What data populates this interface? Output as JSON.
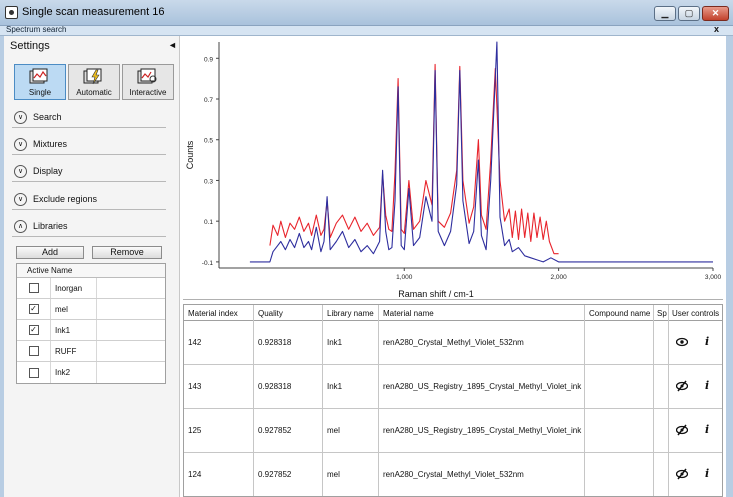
{
  "window": {
    "title": "Single scan measurement 16",
    "panel_title": "Spectrum search",
    "panel_close": "x"
  },
  "sidebar": {
    "heading": "Settings",
    "collapse_glyph": "◄",
    "modes": [
      {
        "label": "Single",
        "selected": true
      },
      {
        "label": "Automatic",
        "selected": false
      },
      {
        "label": "Interactive",
        "selected": false
      }
    ],
    "sections": [
      {
        "label": "Search",
        "expanded": false
      },
      {
        "label": "Mixtures",
        "expanded": false
      },
      {
        "label": "Display",
        "expanded": false
      },
      {
        "label": "Exclude regions",
        "expanded": false
      },
      {
        "label": "Libraries",
        "expanded": true
      }
    ],
    "libraries": {
      "add_label": "Add",
      "remove_label": "Remove",
      "col_active": "Active",
      "col_name": "Name",
      "rows": [
        {
          "name": "Inorgan",
          "active": false
        },
        {
          "name": "mel",
          "active": true
        },
        {
          "name": "Ink1",
          "active": true
        },
        {
          "name": "RUFF",
          "active": false
        },
        {
          "name": "Ink2",
          "active": false
        }
      ]
    }
  },
  "chart_data": {
    "type": "line",
    "xlabel": "Raman shift / cm-1",
    "ylabel": "Counts",
    "xlim": [
      -200,
      3000
    ],
    "ylim": [
      -0.13,
      0.98
    ],
    "x_ticks": [
      "1,000",
      "2,000",
      "3,000"
    ],
    "y_ticks": [
      "-0.1",
      "0.1",
      "0.3",
      "0.5",
      "0.7",
      "0.9"
    ],
    "grid": false,
    "series": [
      {
        "color": "#e8242c",
        "points": [
          [
            130,
            -0.02
          ],
          [
            150,
            0.08
          ],
          [
            180,
            0.03
          ],
          [
            200,
            0.1
          ],
          [
            230,
            0.02
          ],
          [
            260,
            0.09
          ],
          [
            290,
            0.06
          ],
          [
            320,
            0.12
          ],
          [
            350,
            0.05
          ],
          [
            380,
            0.09
          ],
          [
            400,
            0.03
          ],
          [
            430,
            0.13
          ],
          [
            460,
            0.03
          ],
          [
            480,
            0.06
          ],
          [
            500,
            0.2
          ],
          [
            520,
            0.02
          ],
          [
            560,
            0.09
          ],
          [
            600,
            0.13
          ],
          [
            640,
            0.06
          ],
          [
            680,
            0.12
          ],
          [
            720,
            0.05
          ],
          [
            760,
            0.09
          ],
          [
            800,
            0.03
          ],
          [
            840,
            0.07
          ],
          [
            860,
            0.33
          ],
          [
            880,
            0.13
          ],
          [
            900,
            0.06
          ],
          [
            920,
            0.05
          ],
          [
            940,
            0.34
          ],
          [
            960,
            0.8
          ],
          [
            980,
            0.06
          ],
          [
            1000,
            0.04
          ],
          [
            1030,
            0.3
          ],
          [
            1060,
            0.06
          ],
          [
            1100,
            0.1
          ],
          [
            1140,
            0.3
          ],
          [
            1180,
            0.18
          ],
          [
            1200,
            0.87
          ],
          [
            1220,
            0.1
          ],
          [
            1260,
            0.07
          ],
          [
            1300,
            0.14
          ],
          [
            1340,
            0.35
          ],
          [
            1360,
            0.86
          ],
          [
            1380,
            0.3
          ],
          [
            1420,
            0.09
          ],
          [
            1450,
            0.17
          ],
          [
            1480,
            0.5
          ],
          [
            1500,
            0.13
          ],
          [
            1530,
            0.06
          ],
          [
            1560,
            0.4
          ],
          [
            1590,
            0.85
          ],
          [
            1620,
            0.3
          ],
          [
            1650,
            0.1
          ],
          [
            1680,
            0.16
          ],
          [
            1700,
            0.02
          ],
          [
            1720,
            0.15
          ],
          [
            1740,
            0.01
          ],
          [
            1760,
            0.16
          ],
          [
            1780,
            0.02
          ],
          [
            1800,
            0.14
          ],
          [
            1820,
            0.0
          ],
          [
            1840,
            0.14
          ],
          [
            1860,
            0.02
          ],
          [
            1880,
            0.12
          ],
          [
            1900,
            0.01
          ],
          [
            1920,
            0.1
          ],
          [
            1940,
            0.0
          ],
          [
            1970,
            -0.06
          ],
          [
            2000,
            -0.06
          ]
        ]
      },
      {
        "color": "#2e2e9e",
        "points": [
          [
            0,
            -0.1
          ],
          [
            130,
            -0.1
          ],
          [
            150,
            -0.05
          ],
          [
            180,
            -0.02
          ],
          [
            200,
            0.0
          ],
          [
            230,
            -0.04
          ],
          [
            260,
            0.01
          ],
          [
            290,
            -0.03
          ],
          [
            320,
            0.04
          ],
          [
            350,
            -0.03
          ],
          [
            380,
            0.0
          ],
          [
            400,
            -0.04
          ],
          [
            430,
            0.07
          ],
          [
            460,
            -0.05
          ],
          [
            480,
            0.0
          ],
          [
            500,
            0.22
          ],
          [
            520,
            -0.04
          ],
          [
            560,
            0.0
          ],
          [
            600,
            0.05
          ],
          [
            640,
            -0.03
          ],
          [
            680,
            0.01
          ],
          [
            720,
            -0.05
          ],
          [
            760,
            -0.02
          ],
          [
            800,
            -0.06
          ],
          [
            840,
            0.0
          ],
          [
            860,
            0.35
          ],
          [
            880,
            0.05
          ],
          [
            900,
            -0.04
          ],
          [
            920,
            -0.03
          ],
          [
            940,
            0.2
          ],
          [
            960,
            0.76
          ],
          [
            980,
            -0.02
          ],
          [
            1000,
            -0.04
          ],
          [
            1030,
            0.26
          ],
          [
            1060,
            -0.02
          ],
          [
            1100,
            0.02
          ],
          [
            1140,
            0.22
          ],
          [
            1180,
            0.1
          ],
          [
            1200,
            0.84
          ],
          [
            1220,
            0.05
          ],
          [
            1260,
            -0.02
          ],
          [
            1300,
            0.05
          ],
          [
            1340,
            0.28
          ],
          [
            1360,
            0.84
          ],
          [
            1380,
            0.2
          ],
          [
            1420,
            -0.01
          ],
          [
            1450,
            0.05
          ],
          [
            1480,
            0.4
          ],
          [
            1500,
            0.03
          ],
          [
            1530,
            -0.04
          ],
          [
            1560,
            0.3
          ],
          [
            1600,
            0.98
          ],
          [
            1620,
            0.12
          ],
          [
            1650,
            -0.02
          ],
          [
            1680,
            0.01
          ],
          [
            1700,
            -0.05
          ],
          [
            1740,
            -0.03
          ],
          [
            1780,
            -0.07
          ],
          [
            1820,
            -0.08
          ],
          [
            1860,
            -0.09
          ],
          [
            1900,
            -0.1
          ],
          [
            1950,
            -0.08
          ],
          [
            2000,
            -0.1
          ],
          [
            3000,
            -0.1
          ]
        ]
      }
    ]
  },
  "results": {
    "columns": [
      "Material index",
      "Quality",
      "Library name",
      "Material name",
      "Compound name",
      "Sp",
      "User controls"
    ],
    "rows": [
      {
        "index": "142",
        "quality": "0.928318",
        "library": "Ink1",
        "material": "renA280_Crystal_Methyl_Violet_532nm",
        "compound": "",
        "visibility_icon": "eye-icon",
        "info": "i"
      },
      {
        "index": "143",
        "quality": "0.928318",
        "library": "Ink1",
        "material": "renA280_US_Registry_1895_Crystal_Methyl_Violet_ink",
        "compound": "",
        "visibility_icon": "eye-off-icon",
        "info": "i"
      },
      {
        "index": "125",
        "quality": "0.927852",
        "library": "mel",
        "material": "renA280_US_Registry_1895_Crystal_Methyl_Violet_ink",
        "compound": "",
        "visibility_icon": "eye-off-icon",
        "info": "i"
      },
      {
        "index": "124",
        "quality": "0.927852",
        "library": "mel",
        "material": "renA280_Crystal_Methyl_Violet_532nm",
        "compound": "",
        "visibility_icon": "eye-off-icon",
        "info": "i"
      }
    ]
  }
}
